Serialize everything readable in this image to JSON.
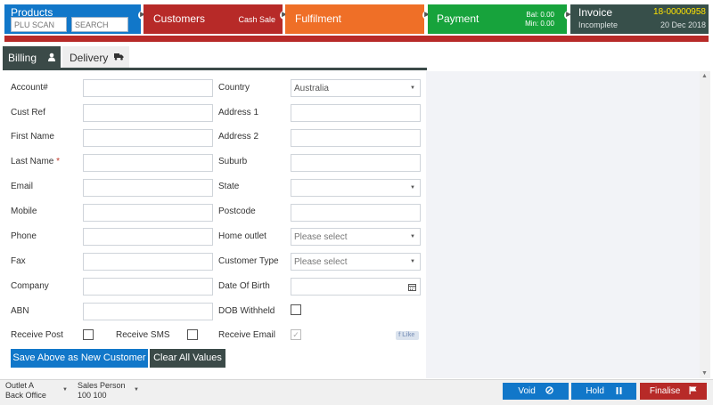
{
  "steps": {
    "products": {
      "title": "Products",
      "plu_placeholder": "PLU SCAN",
      "search_placeholder": "SEARCH"
    },
    "customers": {
      "title": "Customers",
      "sub": "Cash Sale"
    },
    "fulfilment": {
      "title": "Fulfilment"
    },
    "payment": {
      "title": "Payment",
      "bal": "Bal:  0.00",
      "min": "Min:  0.00"
    },
    "invoice": {
      "title": "Invoice",
      "number": "18-00000958",
      "status": "Incomplete",
      "date": "20 Dec 2018"
    }
  },
  "tabs": {
    "billing": "Billing",
    "delivery": "Delivery"
  },
  "form": {
    "account": "Account#",
    "cust_ref": "Cust Ref",
    "first_name": "First Name",
    "last_name": "Last Name",
    "required_mark": "*",
    "email": "Email",
    "mobile": "Mobile",
    "phone": "Phone",
    "fax": "Fax",
    "company": "Company",
    "abn": "ABN",
    "receive_post": "Receive Post",
    "receive_sms": "Receive SMS",
    "country": "Country",
    "country_value": "Australia",
    "address1": "Address 1",
    "address2": "Address 2",
    "suburb": "Suburb",
    "state": "State",
    "postcode": "Postcode",
    "home_outlet": "Home outlet",
    "home_outlet_placeholder": "Please select",
    "customer_type": "Customer Type",
    "customer_type_placeholder": "Please select",
    "dob": "Date Of Birth",
    "dob_withheld": "DOB Withheld",
    "receive_email": "Receive Email",
    "fb_label": "f Like"
  },
  "buttons": {
    "save": "Save Above as New Customer",
    "clear": "Clear All Values"
  },
  "bottom": {
    "outlet": "Outlet A",
    "office": "Back Office",
    "sales_label": "Sales Person",
    "sales_value": "100 100",
    "void": "Void",
    "hold": "Hold",
    "finalise": "Finalise"
  },
  "colors": {
    "blue": "#1177c9",
    "red": "#b72a28",
    "orange": "#ef6f27",
    "green": "#17a33c",
    "dark": "#374f4a",
    "invoice_number": "#ffe400"
  },
  "icons": [
    "user-icon",
    "truck-icon",
    "calendar-icon",
    "facebook-like-icon",
    "cancel-circle-icon",
    "pause-icon",
    "flag-icon",
    "chevron-right-icon",
    "caret-down-icon"
  ]
}
